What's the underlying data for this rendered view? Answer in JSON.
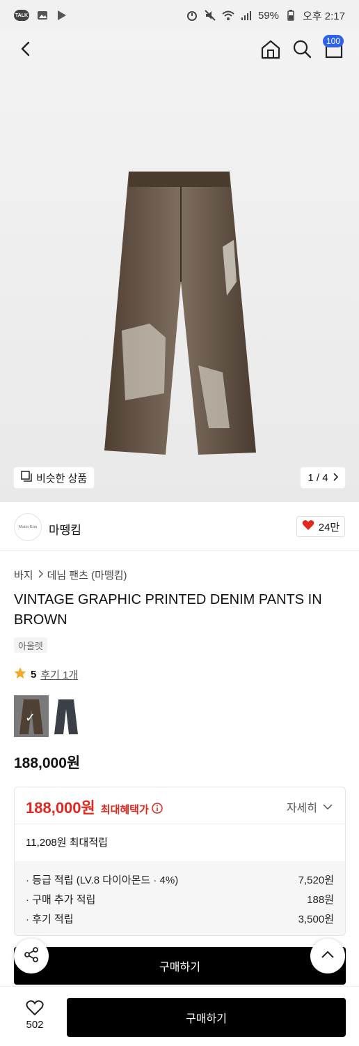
{
  "status_bar": {
    "battery": "59%",
    "time": "오후 2:17",
    "talk_label": "TALK"
  },
  "nav": {
    "cart_count": "100"
  },
  "hero": {
    "similar_label": "비슷한 상품",
    "pager": "1 / 4"
  },
  "brand": {
    "logo_text": "Matin Kim",
    "name": "마뗑킴",
    "likes": "24만"
  },
  "breadcrumb": {
    "category": "바지",
    "sub": "데님 팬츠 (마뗑킴)"
  },
  "product": {
    "title": "VINTAGE GRAPHIC PRINTED DENIM PANTS IN BROWN",
    "tag": "아울렛",
    "rating": "5",
    "reviews": "후기 1개",
    "price": "188,000원"
  },
  "benefit": {
    "max_price": "188,000원",
    "max_label": "최대혜택가",
    "detail_label": "자세히",
    "accumulate": "11,208원 최대적립",
    "rows": [
      {
        "label": "· 등급 적립 (LV.8 다이아몬드 · 4%)",
        "value": "7,520원"
      },
      {
        "label": "· 구매 추가 적립",
        "value": "188원"
      },
      {
        "label": "· 후기 적립",
        "value": "3,500원"
      }
    ]
  },
  "buttons": {
    "buy_inline": "구매하기",
    "buy_main": "구매하기",
    "wish_count": "502"
  },
  "colors": {
    "accent_red": "#e0281e",
    "badge_blue": "#2f62e6"
  }
}
